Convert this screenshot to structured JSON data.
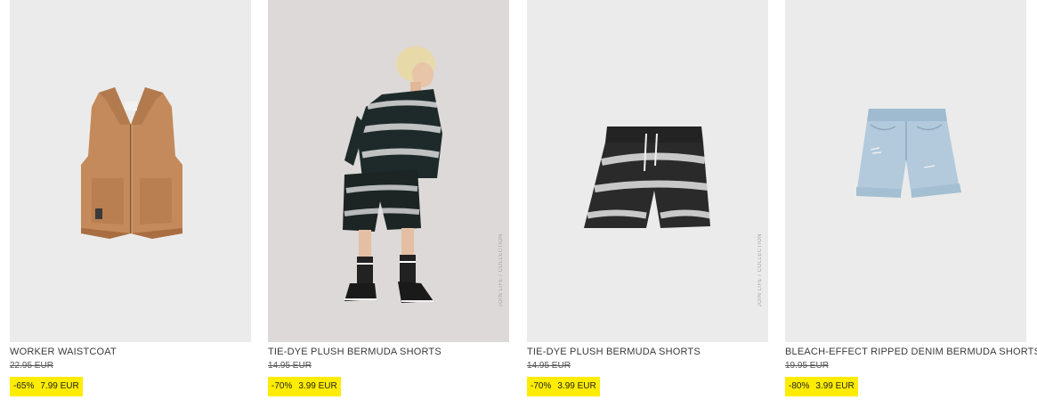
{
  "products": [
    {
      "name": "WORKER WAISTCOAT",
      "old_price": "22.95 EUR",
      "discount": "-65%",
      "price": "7.99 EUR"
    },
    {
      "name": "TIE-DYE PLUSH BERMUDA SHORTS",
      "old_price": "14.95 EUR",
      "discount": "-70%",
      "price": "3.99 EUR",
      "side_text": "JOIN LIFE / COLLECTION"
    },
    {
      "name": "TIE-DYE PLUSH BERMUDA SHORTS",
      "old_price": "14.95 EUR",
      "discount": "-70%",
      "price": "3.99 EUR",
      "side_text": "JOIN LIFE / COLLECTION"
    },
    {
      "name": "BLEACH-EFFECT RIPPED DENIM BERMUDA SHORTS",
      "old_price": "19.95 EUR",
      "discount": "-80%",
      "price": "3.99 EUR"
    }
  ],
  "colors": {
    "sale_highlight": "#ffec00",
    "image_bg": "#ebebeb",
    "studio_bg": "#dcd9d8"
  }
}
